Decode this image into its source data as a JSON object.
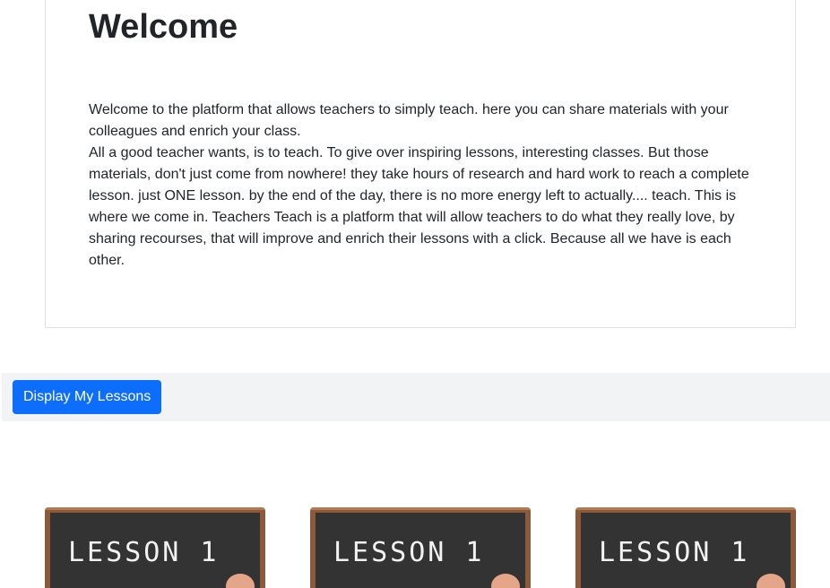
{
  "welcome": {
    "title": "Welcome",
    "paragraph_1": "Welcome to the platform that allows teachers to simply teach. here you can share materials with your colleagues and enrich your class.",
    "paragraph_2": "All a good teacher wants, is to teach. To give over inspiring lessons, interesting classes. But those materials, don't just come from nowhere! they take hours of research and hard work to reach a complete lesson. just ONE lesson. by the end of the day, there is no more energy left to actually.... teach. This is where we come in. Teachers Teach is a platform that will allow teachers to do what they really love, by sharing recourses, that will improve and enrich their lessons with a click. Because all we have is each other."
  },
  "toolbar": {
    "display_button_label": "Display My Lessons",
    "button_color": "#0d6efd"
  },
  "lessons": [
    {
      "image_text": "LESSON 1"
    },
    {
      "image_text": "LESSON 1"
    },
    {
      "image_text": "LESSON 1"
    }
  ]
}
